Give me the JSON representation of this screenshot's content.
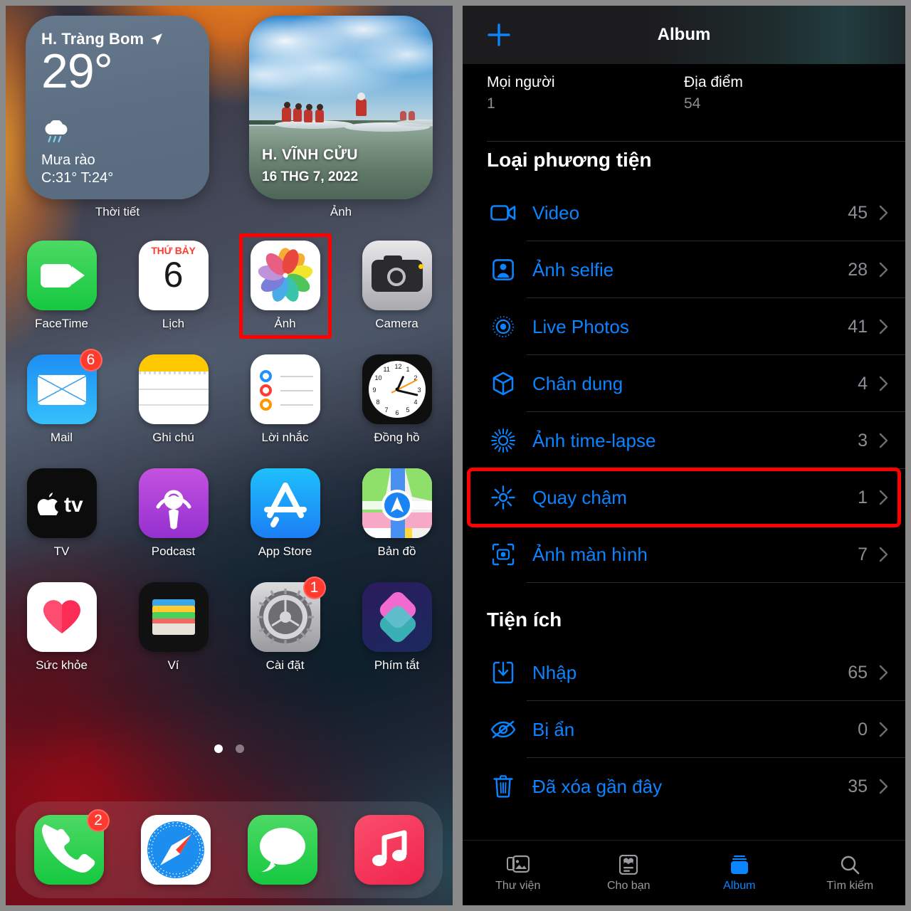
{
  "left_screen": {
    "name": "iOS Home Screen",
    "widgets": [
      {
        "id": "weather",
        "label": "Thời tiết",
        "city": "H. Tràng Bom",
        "temperature": "29°",
        "condition": "Mưa rào",
        "high_low": "C:31° T:24°",
        "location_icon": "location-arrow-icon",
        "weather_icon": "rain-cloud-icon"
      },
      {
        "id": "photos",
        "label": "Ảnh",
        "memory_title": "H. VĨNH CỬU",
        "memory_date": "16 THG 7, 2022"
      }
    ],
    "app_rows": [
      [
        {
          "label": "FaceTime",
          "icon": "facetime-icon",
          "badge": null,
          "highlighted": false
        },
        {
          "label": "Lịch",
          "icon": "calendar-icon",
          "badge": null,
          "highlighted": false,
          "calendar_weekday": "THỨ BẢY",
          "calendar_day": "6"
        },
        {
          "label": "Ảnh",
          "icon": "photos-icon",
          "badge": null,
          "highlighted": true
        },
        {
          "label": "Camera",
          "icon": "camera-icon",
          "badge": null,
          "highlighted": false
        }
      ],
      [
        {
          "label": "Mail",
          "icon": "mail-icon",
          "badge": "6",
          "highlighted": false
        },
        {
          "label": "Ghi chú",
          "icon": "notes-icon",
          "badge": null,
          "highlighted": false
        },
        {
          "label": "Lời nhắc",
          "icon": "reminders-icon",
          "badge": null,
          "highlighted": false
        },
        {
          "label": "Đồng hồ",
          "icon": "clock-icon",
          "badge": null,
          "highlighted": false
        }
      ],
      [
        {
          "label": "TV",
          "icon": "appletv-icon",
          "badge": null,
          "highlighted": false
        },
        {
          "label": "Podcast",
          "icon": "podcasts-icon",
          "badge": null,
          "highlighted": false
        },
        {
          "label": "App Store",
          "icon": "appstore-icon",
          "badge": null,
          "highlighted": false
        },
        {
          "label": "Bản đồ",
          "icon": "maps-icon",
          "badge": null,
          "highlighted": false
        }
      ],
      [
        {
          "label": "Sức khỏe",
          "icon": "health-icon",
          "badge": null,
          "highlighted": false
        },
        {
          "label": "Ví",
          "icon": "wallet-icon",
          "badge": null,
          "highlighted": false
        },
        {
          "label": "Cài đặt",
          "icon": "settings-gear-icon",
          "badge": "1",
          "highlighted": false
        },
        {
          "label": "Phím tắt",
          "icon": "shortcuts-icon",
          "badge": null,
          "highlighted": false
        }
      ]
    ],
    "page_dots": {
      "count": 2,
      "active_index": 0
    },
    "dock": [
      {
        "label": "Phone",
        "icon": "phone-icon",
        "badge": "2"
      },
      {
        "label": "Safari",
        "icon": "safari-compass-icon",
        "badge": null
      },
      {
        "label": "Messages",
        "icon": "messages-bubble-icon",
        "badge": null
      },
      {
        "label": "Music",
        "icon": "music-note-icon",
        "badge": null
      }
    ]
  },
  "right_screen": {
    "nav": {
      "add_icon": "plus-icon",
      "title": "Album"
    },
    "people_places": [
      {
        "title": "Mọi người",
        "count": "1"
      },
      {
        "title": "Địa điểm",
        "count": "54"
      }
    ],
    "sections": [
      {
        "header": "Loại phương tiện",
        "rows": [
          {
            "label": "Video",
            "count": "45",
            "icon": "video-camera-icon",
            "highlighted": false
          },
          {
            "label": "Ảnh selfie",
            "count": "28",
            "icon": "person-portrait-icon",
            "highlighted": false
          },
          {
            "label": "Live Photos",
            "count": "41",
            "icon": "live-photo-icon",
            "highlighted": false
          },
          {
            "label": "Chân dung",
            "count": "4",
            "icon": "cube-icon",
            "highlighted": false
          },
          {
            "label": "Ảnh time-lapse",
            "count": "3",
            "icon": "timelapse-icon",
            "highlighted": false
          },
          {
            "label": "Quay chậm",
            "count": "1",
            "icon": "slowmo-icon",
            "highlighted": true
          },
          {
            "label": "Ảnh màn hình",
            "count": "7",
            "icon": "screenshot-icon",
            "highlighted": false
          }
        ]
      },
      {
        "header": "Tiện ích",
        "rows": [
          {
            "label": "Nhập",
            "count": "65",
            "icon": "import-download-icon",
            "highlighted": false
          },
          {
            "label": "Bị ẩn",
            "count": "0",
            "icon": "eye-slash-icon",
            "highlighted": false
          },
          {
            "label": "Đã xóa gần đây",
            "count": "35",
            "icon": "trash-icon",
            "highlighted": false
          }
        ]
      }
    ],
    "tabbar": [
      {
        "label": "Thư viện",
        "icon": "photo-stack-icon",
        "active": false
      },
      {
        "label": "Cho bạn",
        "icon": "foryou-card-icon",
        "active": false
      },
      {
        "label": "Album",
        "icon": "albums-icon",
        "active": true
      },
      {
        "label": "Tìm kiếm",
        "icon": "search-magnifier-icon",
        "active": false
      }
    ]
  },
  "colors": {
    "accent_blue": "#0a84ff",
    "highlight_red": "#ff0000",
    "badge_red": "#ff3b30",
    "secondary_gray": "#8d8d93",
    "background_black": "#000000"
  }
}
